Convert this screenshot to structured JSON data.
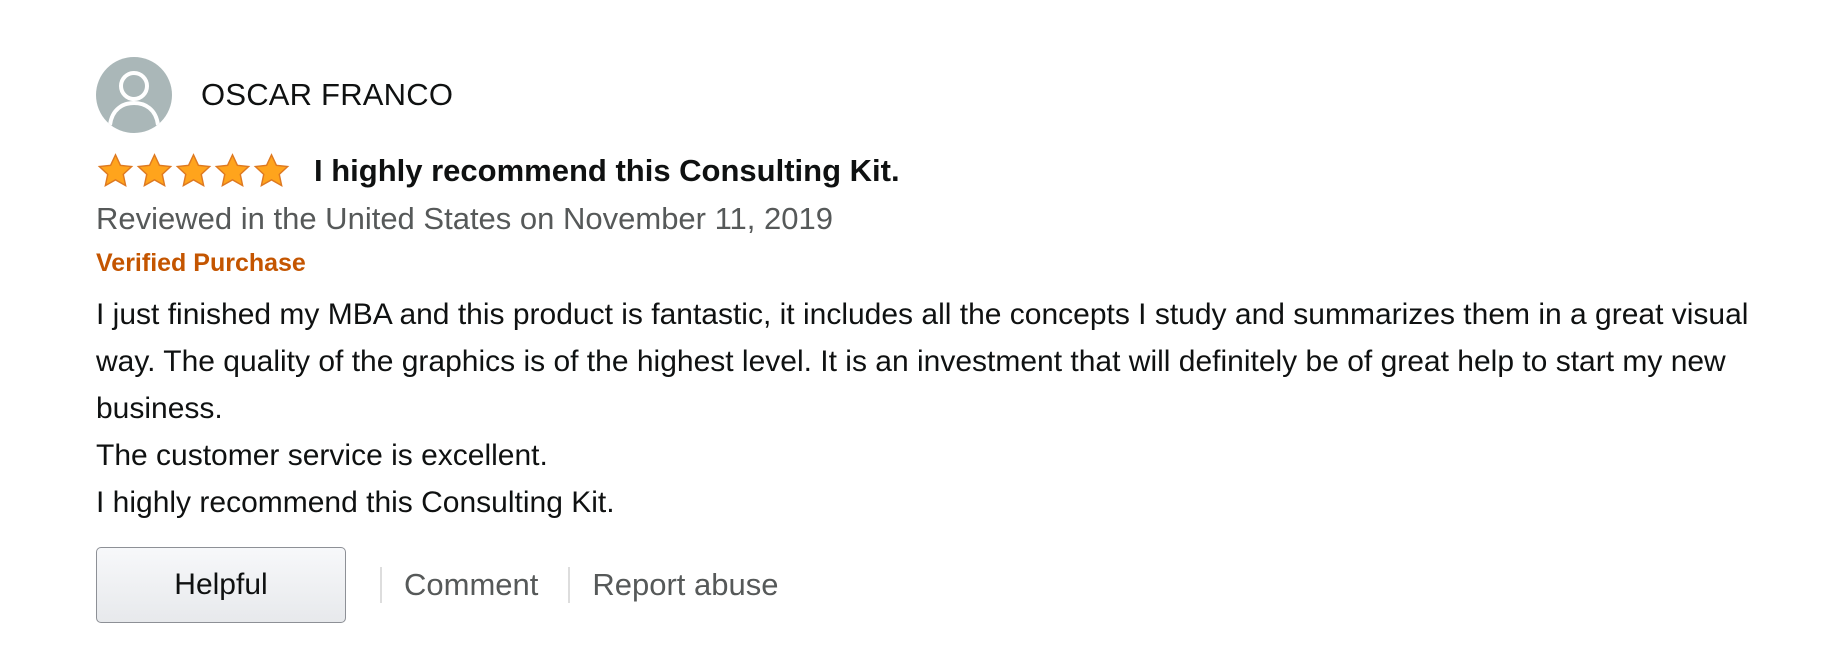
{
  "review": {
    "profile_name": "OSCAR FRANCO",
    "rating": 5,
    "max_rating": 5,
    "star_color": "#ffa41c",
    "title": "I highly recommend this Consulting Kit.",
    "date_text": "Reviewed in the United States on November 11, 2019",
    "verified_label": "Verified Purchase",
    "verified_color": "#c45500",
    "body": {
      "paragraph_1": "I just finished my MBA and this product is fantastic, it includes all the concepts I study and summarizes them in a great visual way. The quality of the graphics is of the highest level. It is an investment that will definitely be of great help to start my new business.",
      "paragraph_2": "The customer service is excellent.",
      "paragraph_3": "I highly recommend this Consulting Kit."
    }
  },
  "actions": {
    "helpful_label": "Helpful",
    "comment_label": "Comment",
    "report_label": "Report abuse"
  },
  "icons": {
    "avatar": "user-avatar-icon",
    "star": "star-filled-icon"
  }
}
